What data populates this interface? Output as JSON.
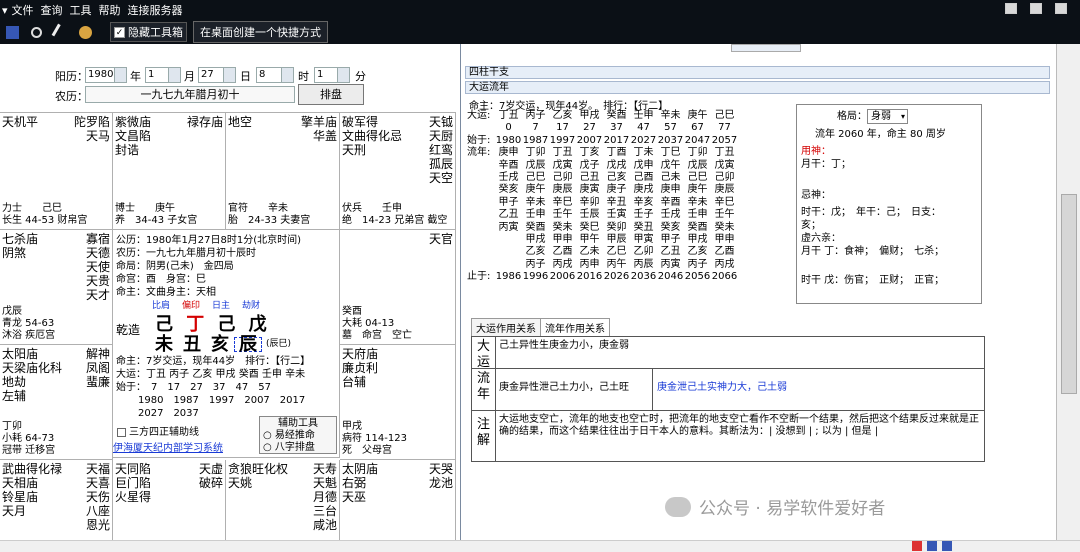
{
  "menu": [
    "文件",
    "查询",
    "工具",
    "帮助",
    "连接服务器"
  ],
  "toolbar": {
    "hide_label": "隐藏工具箱",
    "shortcut_label": "在桌面创建一个快捷方式"
  },
  "datebar": {
    "solar_label": "阳历：",
    "year": "1980",
    "year_unit": "年",
    "month": "1",
    "month_unit": "月",
    "day": "27",
    "day_unit": "日",
    "hour": "8",
    "hour_unit": "时",
    "minute": "1",
    "minute_unit": "分",
    "lunar_label": "农历：",
    "lunar_value": "一九七九年腊月初十",
    "paipan": "排盘"
  },
  "palaces": [
    {
      "main": "天机平",
      "right": "陀罗陷\n天马",
      "bot": "力士　　己巳\n长生 44-53 财帛宫"
    },
    {
      "main": "紫微庙\n文昌陷\n封诰",
      "right": "禄存庙",
      "bot": "博士　　庚午\n养　34-43 子女宫"
    },
    {
      "main": "地空",
      "right": "擎羊庙\n华盖",
      "bot": "官符　　辛未\n胎　24-33 夫妻宫"
    },
    {
      "main": "破军得\n文曲得化忌\n天刑",
      "right": "天钺\n天厨\n红鸾\n孤辰\n天空",
      "bot": "伏兵　　壬申\n绝　14-23 兄弟宫 截空"
    },
    {
      "main": "七杀庙\n阴煞",
      "right": "寡宿\n天德\n天使\n天贵\n天才",
      "bot": "戊辰\n青龙 54-63\n沐浴 疾厄宫"
    },
    {
      "main": "",
      "right": "天官",
      "bot": "癸酉\n大耗 04-13\n墓　命宫　空亡"
    },
    {
      "main": "太阳庙\n天梁庙化科\n地劫\n左辅",
      "right": "解神\n凤阁\n蜚廉",
      "bot": "丁卯\n小耗 64-73\n冠带 迁移宫"
    },
    {
      "main": "天府庙\n廉贞利\n台辅",
      "right": "",
      "bot": "甲戌\n病符 114-123\n死　父母宫"
    },
    {
      "main": "武曲得化禄\n天相庙\n铃星庙\n天月",
      "right": "天福\n天喜\n天伤\n八座\n恩光",
      "bot": ""
    },
    {
      "main": "天同陷\n巨门陷\n火星得",
      "right": "天虚\n破碎",
      "bot": ""
    },
    {
      "main": "贪狼旺化权\n天姚",
      "right": "天寿\n天魁\n月德\n三台\n咸池",
      "bot": ""
    },
    {
      "main": "太阴庙\n右弼\n天巫",
      "right": "天哭\n龙池",
      "bot": ""
    }
  ],
  "center": {
    "gongli": "公历：1980年1月27日8时1分(北京时间)",
    "nongli": "农历：一九七九年腊月初十辰时",
    "mingju": "命局：阴男(己未)　金四局",
    "minggong": "命宫：酉　身宫：巳",
    "mingzhu": "命主：文曲身主：天相",
    "gods": [
      "比肩",
      "偏印",
      "日主",
      "劫财"
    ],
    "qianzao": "乾造",
    "stems": [
      "己",
      "丁",
      "己",
      "戊"
    ],
    "branches": [
      "未",
      "丑",
      "亥",
      "辰"
    ],
    "chenyi": "(辰巳)",
    "mingzhu2": "命主：7岁交运，现年44岁　排行：【行二】",
    "dayun": "大运：丁丑 丙子 乙亥 甲戌 癸酉 壬申 辛未",
    "shiyu": "始于：　7　17　27　37　47　57",
    "years": "1980　1987　1997　2007　2017　2027　2037",
    "aux_title": "辅助工具",
    "aux1": "易经推命",
    "aux2": "八字排盘",
    "sanfang": "三方四正辅助线",
    "link": "伊海厦天纪内部学习系统"
  },
  "right": {
    "sizhu": "四柱干支",
    "dayun_hdr": "大运流年",
    "top_text": "命主：7岁交运，现年44岁。　排行：【行二】",
    "rows": [
      {
        "lab": "大运:",
        "cells": [
          "丁丑",
          "丙子",
          "乙亥",
          "甲戌",
          "癸酉",
          "壬申",
          "辛未",
          "庚午",
          "己巳"
        ]
      },
      {
        "lab": "",
        "cells": [
          "0",
          "7",
          "17",
          "27",
          "37",
          "47",
          "57",
          "67",
          "77"
        ]
      },
      {
        "lab": "始于:",
        "cells": [
          "1980",
          "1987",
          "1997",
          "2007",
          "2017",
          "2027",
          "2037",
          "2047",
          "2057"
        ]
      },
      {
        "lab": "流年:",
        "cells": [
          "庚申",
          "丁卯",
          "丁丑",
          "丁亥",
          "丁酉",
          "丁未",
          "丁巳",
          "丁卯",
          "丁丑"
        ]
      },
      {
        "lab": "",
        "cells": [
          "辛酉",
          "戊辰",
          "戊寅",
          "戊子",
          "戊戌",
          "戊申",
          "戊午",
          "戊辰",
          "戊寅"
        ]
      },
      {
        "lab": "",
        "cells": [
          "壬戌",
          "己巳",
          "己卯",
          "己丑",
          "己亥",
          "己酉",
          "己未",
          "己巳",
          "己卯"
        ]
      },
      {
        "lab": "",
        "cells": [
          "癸亥",
          "庚午",
          "庚辰",
          "庚寅",
          "庚子",
          "庚戌",
          "庚申",
          "庚午",
          "庚辰"
        ]
      },
      {
        "lab": "",
        "cells": [
          "甲子",
          "辛未",
          "辛巳",
          "辛卯",
          "辛丑",
          "辛亥",
          "辛酉",
          "辛未",
          "辛巳"
        ]
      },
      {
        "lab": "",
        "cells": [
          "乙丑",
          "壬申",
          "壬午",
          "壬辰",
          "壬寅",
          "壬子",
          "壬戌",
          "壬申",
          "壬午"
        ]
      },
      {
        "lab": "",
        "cells": [
          "丙寅",
          "癸酉",
          "癸未",
          "癸巳",
          "癸卯",
          "癸丑",
          "癸亥",
          "癸酉",
          "癸未"
        ]
      },
      {
        "lab": "",
        "cells": [
          "",
          "甲戌",
          "甲申",
          "甲午",
          "甲辰",
          "甲寅",
          "甲子",
          "甲戌",
          "甲申"
        ]
      },
      {
        "lab": "",
        "cells": [
          "",
          "乙亥",
          "乙酉",
          "乙未",
          "乙巳",
          "乙卯",
          "乙丑",
          "乙亥",
          "乙酉"
        ]
      },
      {
        "lab": "",
        "cells": [
          "",
          "丙子",
          "丙戌",
          "丙申",
          "丙午",
          "丙辰",
          "丙寅",
          "丙子",
          "丙戌"
        ]
      },
      {
        "lab": "止于:",
        "cells": [
          "1986",
          "1996",
          "2006",
          "2016",
          "2026",
          "2036",
          "2046",
          "2056",
          "2066"
        ]
      }
    ],
    "geju_label": "格局：",
    "geju_value": "身弱",
    "liunian": "流年 2060 年，命主 80 周岁",
    "yongshen": "用神：",
    "yuegan": "月干：丁；",
    "jishen": "忌神：",
    "hai": "亥；",
    "shigan": "时干：戊；　年干：己；　日支：",
    "xuliuqin": "虚六亲：",
    "yuegan2": "月干 丁：食神；　偏财；　七杀；",
    "shigan2": "时干 戊：伤官；　正财；　正官；",
    "tab1": "大运作用关系",
    "tab2": "流年作用关系",
    "r1_lab": "大\n运",
    "r1_text": "己土异性生庚金力小，庚金弱",
    "r2_lab": "流\n年",
    "r2_text": "庚金异性泄己土力小，己土旺",
    "r2_text2": "庚金泄己土实神力大，己土弱",
    "r3_lab": "注\n解",
    "r3_text": "大运地支空亡，流年的地支也空亡时，把流年的地支空亡看作不空断一个结果，然后把这个结果反过来就是正确的结果，而这个结果往往出于日干本人的意料。其断法为：| 没想到 | ; 以为 | 但是 |"
  },
  "watermark": "公众号 · 易学软件爱好者",
  "colors": {
    "blue": "#1a3bd6",
    "red": "#d40000",
    "titlebar": "#0b1016"
  }
}
